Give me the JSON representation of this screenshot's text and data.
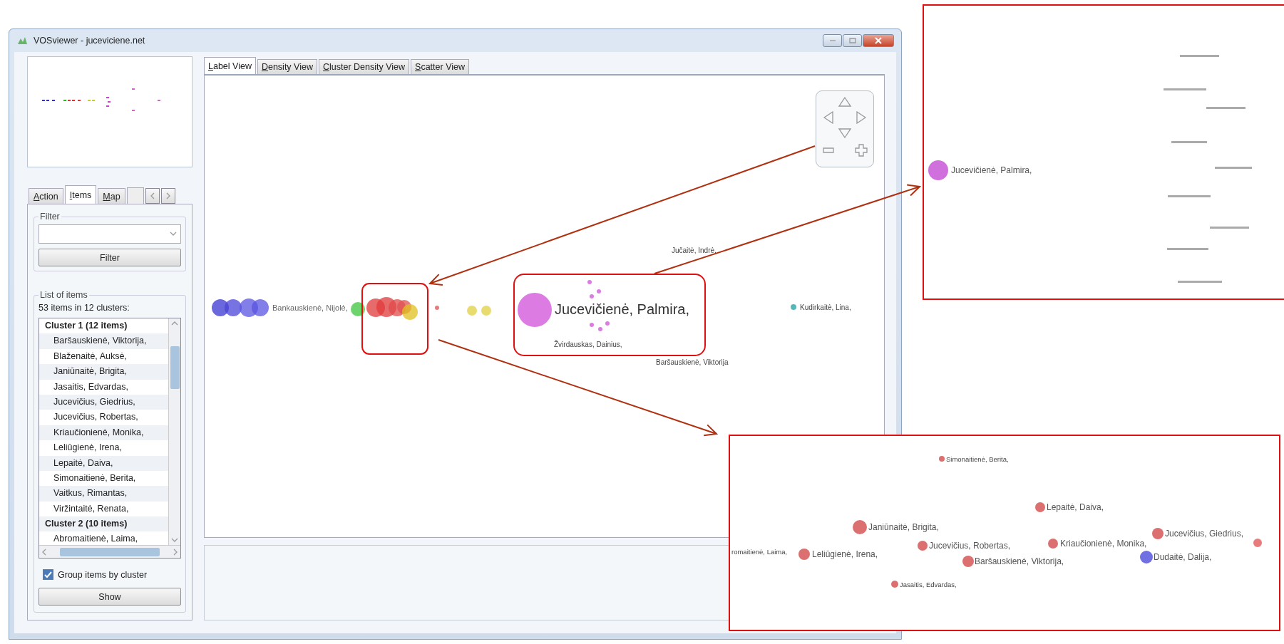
{
  "window": {
    "title": "VOSviewer - juceviciene.net"
  },
  "side_panel": {
    "tabs": [
      {
        "label": "Action",
        "selected": false
      },
      {
        "label": "Items",
        "selected": true
      },
      {
        "label": "Map",
        "selected": false
      }
    ],
    "filter": {
      "title": "Filter",
      "button": "Filter"
    },
    "items": {
      "title": "List of items",
      "summary": "53 items in 12 clusters:",
      "clusters": [
        {
          "title": "Cluster 1 (12 items)",
          "items": [
            "Baršauskienė, Viktorija,",
            "Blaženaitė, Auksė,",
            "Janiūnaitė, Brigita,",
            "Jasaitis, Edvardas,",
            "Jucevičius, Giedrius,",
            "Jucevičius, Robertas,",
            "Kriaučionienė, Monika,",
            "Leliūgienė, Irena,",
            "Lepaitė, Daiva,",
            "Simonaitienė, Berita,",
            "Vaitkus, Rimantas,",
            "Viržintaitė, Renata,"
          ]
        },
        {
          "title": "Cluster 2 (10 items)",
          "items": [
            "Abromaitienė, Laima,"
          ]
        }
      ]
    },
    "group_by_cluster": {
      "label": "Group items by cluster",
      "checked": true
    },
    "show_button": "Show"
  },
  "view_tabs": [
    {
      "label": "Label View",
      "selected": true
    },
    {
      "label": "Density View",
      "selected": false
    },
    {
      "label": "Cluster Density View",
      "selected": false
    },
    {
      "label": "Scatter View",
      "selected": false
    }
  ],
  "map": {
    "labels": [
      {
        "text": "Bankauskienė, Nijolė,",
        "kind": "medium"
      },
      {
        "text": "Jucevičienė, Palmira,",
        "kind": "large"
      },
      {
        "text": "Jučaitė, Indrė,",
        "kind": "small"
      },
      {
        "text": "Žvirdauskas, Dainius,",
        "kind": "small"
      },
      {
        "text": "Kudirkaitė, Lina,",
        "kind": "small"
      },
      {
        "text": "Baršauskienė, Viktorija",
        "kind": "small"
      }
    ]
  },
  "zoom_insets": [
    {
      "labels": [
        {
          "text": "Jucevičienė, Palmira,",
          "kind": "medium"
        }
      ]
    },
    {
      "labels": [
        {
          "text": "Simonaitienė, Berita,",
          "kind": "small"
        },
        {
          "text": "Lepaitė, Daiva,",
          "kind": "medium"
        },
        {
          "text": "Janiūnaitė, Brigita,",
          "kind": "medium"
        },
        {
          "text": "Jucevičius, Giedrius,",
          "kind": "medium"
        },
        {
          "text": "Jucevičius, Robertas,",
          "kind": "medium"
        },
        {
          "text": "Kriaučionienė, Monika,",
          "kind": "medium"
        },
        {
          "text": "romaitienė, Laima,",
          "kind": "small"
        },
        {
          "text": "Leliūgienė, Irena,",
          "kind": "medium"
        },
        {
          "text": "Baršauskienė, Viktorija,",
          "kind": "medium"
        },
        {
          "text": "Dudaitė, Dalija,",
          "kind": "medium"
        },
        {
          "text": "Jasaitis, Edvardas,",
          "kind": "small"
        }
      ]
    }
  ]
}
